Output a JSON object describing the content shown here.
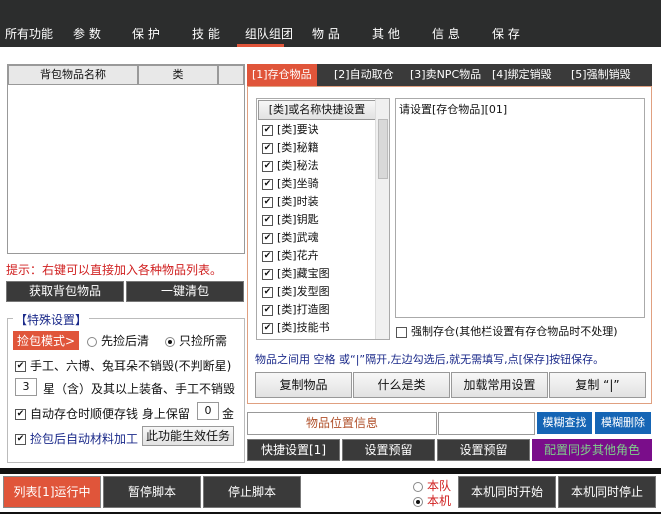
{
  "nav": [
    "所有功能",
    "参 数",
    "保 护",
    "技 能",
    "组队组团",
    "物 品",
    "其 他",
    "信 息",
    "保 存"
  ],
  "left": {
    "col_name": "背包物品名称",
    "col_type": "类",
    "hint": "提示：右键可以直接加入各种物品列表。",
    "get_items": "获取背包物品",
    "clear_bag": "一键清包",
    "special": {
      "title": "【特殊设置】",
      "mode_label": "捡包模式>",
      "opt1": "先捡后清",
      "opt2": "只捡所需",
      "chk1": "手工、六博、兔耳朵不销毁(不判断星)",
      "star_value": "3",
      "star_text": "星（含）及其以上装备、手工不销毁",
      "chk2": "自动存仓时顺便存钱 身上保留",
      "gold_value": "0",
      "gold_unit": "金",
      "chk3": "捡包后自动材料加工",
      "task_btn": "此功能生效任务"
    }
  },
  "tabs": [
    "[1]存仓物品",
    "[2]自动取仓",
    "[3]卖NPC物品",
    "[4]绑定销毁",
    "[5]强制销毁"
  ],
  "panel": {
    "list_header": "[类]或名称快捷设置",
    "items": [
      "[类]要诀",
      "[类]秘籍",
      "[类]秘法",
      "[类]坐骑",
      "[类]时装",
      "[类]钥匙",
      "[类]武魂",
      "[类]花卉",
      "[类]藏宝图",
      "[类]发型图",
      "[类]打造图",
      "[类]技能书"
    ],
    "text": "请设置[存仓物品][01]",
    "force": "强制存仓(其他栏设置有存仓物品时不处理)",
    "hint": "物品之间用 空格 或“|”隔开,左边勾选后,就无需填写,点[保存]按钮保存。",
    "buttons": [
      "复制物品",
      "什么是类",
      "加载常用设置",
      "复制 “|”"
    ]
  },
  "pos_info": "物品位置信息",
  "search_value": "",
  "fuzzy_find": "模糊查找",
  "fuzzy_delete": "模糊删除",
  "row2": [
    "快捷设置[1]",
    "设置预留",
    "设置预留",
    "配置同步其他角色"
  ],
  "bottom": {
    "running": "列表[1]运行中",
    "pause": "暂停脚本",
    "stop": "停止脚本",
    "team": "本队",
    "local": "本机",
    "start_all": "本机同时开始",
    "stop_all": "本机同时停止"
  },
  "colors": {
    "accent": "#e0553a",
    "dark": "#2c2d2d",
    "blue": "#1565b5",
    "purple": "#7a0d8a"
  }
}
